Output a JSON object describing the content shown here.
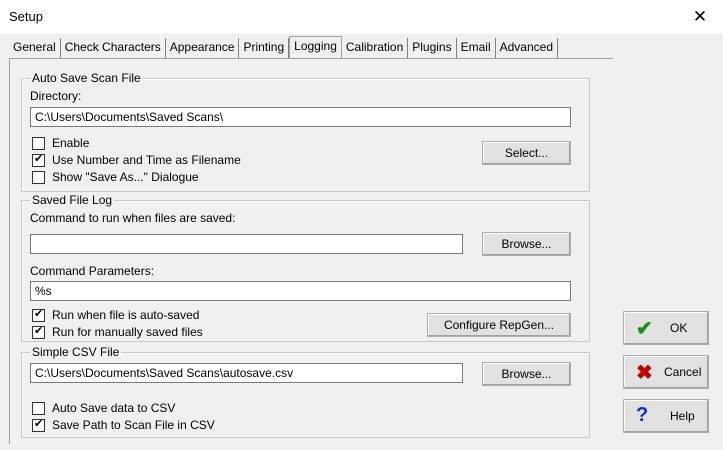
{
  "window": {
    "title": "Setup",
    "close_glyph": "✕"
  },
  "tabs": [
    {
      "label": "General"
    },
    {
      "label": "Check Characters"
    },
    {
      "label": "Appearance"
    },
    {
      "label": "Printing"
    },
    {
      "label": "Logging",
      "active": true
    },
    {
      "label": "Calibration"
    },
    {
      "label": "Plugins"
    },
    {
      "label": "Email"
    },
    {
      "label": "Advanced"
    }
  ],
  "auto_save": {
    "legend": "Auto Save Scan File",
    "directory_label": "Directory:",
    "directory_value": "C:\\Users\\Documents\\Saved Scans\\",
    "enable_label": "Enable",
    "enable_checked": false,
    "use_number_label": "Use Number and Time as Filename",
    "use_number_checked": true,
    "show_save_as_label": "Show \"Save As...\" Dialogue",
    "show_save_as_checked": false,
    "select_button": "Select..."
  },
  "saved_file_log": {
    "legend": "Saved File Log",
    "command_label": "Command to run when files are saved:",
    "command_value": "",
    "browse_button": "Browse...",
    "params_label": "Command Parameters:",
    "params_value": "%s",
    "run_auto_label": "Run when file is auto-saved",
    "run_auto_checked": true,
    "run_manual_label": "Run for manually saved files",
    "run_manual_checked": true,
    "configure_button": "Configure RepGen..."
  },
  "csv": {
    "legend": "Simple CSV File",
    "path_value": "C:\\Users\\Documents\\Saved Scans\\autosave.csv",
    "browse_button": "Browse...",
    "auto_save_csv_label": "Auto Save data to CSV",
    "auto_save_csv_checked": false,
    "save_path_label": "Save Path to Scan File in CSV",
    "save_path_checked": true
  },
  "buttons": {
    "ok": "OK",
    "cancel": "Cancel",
    "help": "Help",
    "ok_color": "#1a8f1a",
    "cancel_color": "#c00000",
    "help_color": "#1030c0"
  }
}
